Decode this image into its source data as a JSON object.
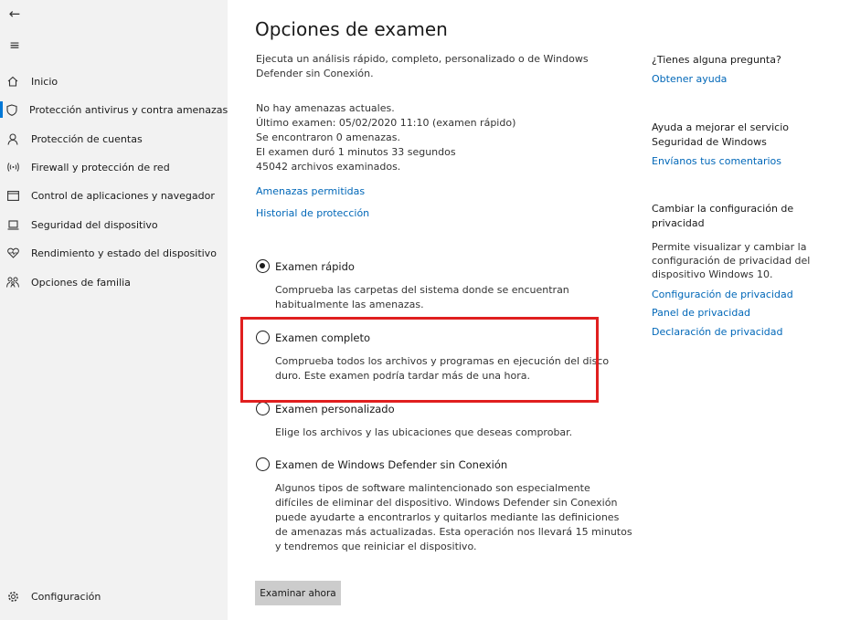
{
  "sidebar": {
    "back_glyph": "←",
    "menu_glyph": "≡",
    "items": [
      {
        "label": "Inicio",
        "icon": "home-icon"
      },
      {
        "label": "Protección antivirus y contra amenazas",
        "icon": "shield-icon"
      },
      {
        "label": "Protección de cuentas",
        "icon": "person-icon"
      },
      {
        "label": "Firewall y protección de red",
        "icon": "wifi-icon"
      },
      {
        "label": "Control de aplicaciones y navegador",
        "icon": "browser-window-icon"
      },
      {
        "label": "Seguridad del dispositivo",
        "icon": "laptop-icon"
      },
      {
        "label": "Rendimiento y estado del dispositivo",
        "icon": "heart-icon"
      },
      {
        "label": "Opciones de familia",
        "icon": "family-icon"
      }
    ],
    "settings_label": "Configuración"
  },
  "main": {
    "title": "Opciones de examen",
    "intro_line1": "Ejecuta un análisis rápido, completo, personalizado o de Windows",
    "intro_line2": "Defender sin Conexión.",
    "status": [
      "No hay amenazas actuales.",
      "Último examen: 05/02/2020 11:10 (examen rápido)",
      "Se encontraron 0 amenazas.",
      "El examen duró 1 minutos 33 segundos",
      "45042 archivos examinados."
    ],
    "link_allowed": "Amenazas permitidas",
    "link_history": "Historial de protección",
    "options": [
      {
        "label": "Examen rápido",
        "checked": true,
        "desc": [
          "Comprueba las carpetas del sistema donde se encuentran",
          "habitualmente las amenazas."
        ]
      },
      {
        "label": "Examen completo",
        "checked": false,
        "desc": [
          "Comprueba todos los archivos y programas en ejecución del disco",
          "duro. Este examen podría tardar más de una hora."
        ]
      },
      {
        "label": "Examen personalizado",
        "checked": false,
        "desc": [
          "Elige los archivos y las ubicaciones que deseas comprobar."
        ]
      },
      {
        "label": "Examen de Windows Defender sin Conexión",
        "checked": false,
        "desc": [
          "Algunos tipos de software malintencionado son especialmente",
          "difíciles de eliminar del dispositivo. Windows Defender sin Conexión",
          "puede ayudarte a encontrarlos y quitarlos mediante las definiciones",
          "de amenazas más actualizadas. Esta operación nos llevará 15 minutos",
          "y tendremos que reiniciar el dispositivo."
        ]
      }
    ],
    "scan_button": "Examinar ahora",
    "highlight_color": "#e01f1f"
  },
  "right": {
    "question_title": "¿Tienes alguna pregunta?",
    "help_link": "Obtener ayuda",
    "improve_title_1": "Ayuda a mejorar el servicio",
    "improve_title_2": "Seguridad de Windows",
    "feedback_link": "Envíanos tus comentarios",
    "privacy_title_1": "Cambiar la configuración de",
    "privacy_title_2": "privacidad",
    "privacy_desc": [
      "Permite visualizar y cambiar la",
      "configuración de privacidad del",
      "dispositivo Windows 10."
    ],
    "privacy_links": [
      "Configuración de privacidad",
      "Panel de privacidad",
      "Declaración de privacidad"
    ]
  },
  "colors": {
    "accent": "#0078d7",
    "link": "#0067b8",
    "sidebar_bg": "#f2f2f2",
    "button_bg": "#cccccc"
  }
}
